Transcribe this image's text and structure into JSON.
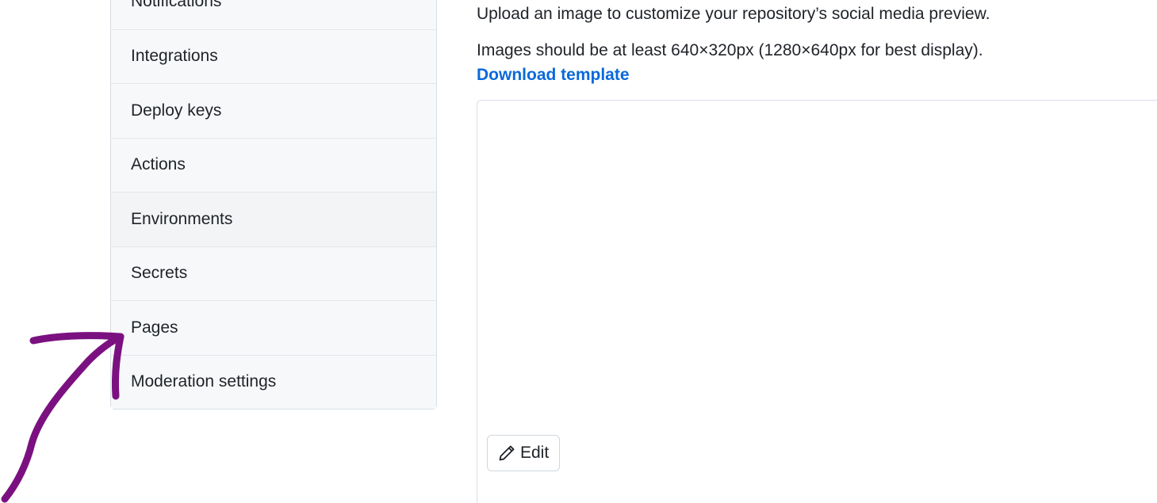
{
  "sidebar": {
    "items": [
      {
        "label": "Notifications"
      },
      {
        "label": "Integrations"
      },
      {
        "label": "Deploy keys"
      },
      {
        "label": "Actions"
      },
      {
        "label": "Environments"
      },
      {
        "label": "Secrets"
      },
      {
        "label": "Pages"
      },
      {
        "label": "Moderation settings"
      }
    ]
  },
  "social_preview": {
    "description": "Upload an image to customize your repository’s social media preview.",
    "size_hint": "Images should be at least 640×320px (1280×640px for best display).",
    "download_link": "Download template",
    "edit_button": "Edit",
    "edit_icon": "pencil-icon"
  },
  "annotation": {
    "type": "hand-drawn-arrow",
    "color": "#7b1180",
    "points_to": "Pages"
  },
  "colors": {
    "link": "#0969da",
    "sidebar_bg": "#f6f8fa",
    "border": "#d8dee4",
    "annotation": "#7b1180"
  }
}
